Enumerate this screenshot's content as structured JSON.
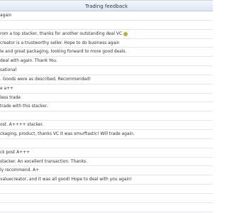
{
  "header": {
    "title": "Trading feedback"
  },
  "feedback": [
    {
      "text": "again"
    },
    {
      "text": ""
    },
    {
      "text": "rom a top stacker, thanks for another outstanding deal VC",
      "smiley": true
    },
    {
      "text": "creator is a trustworthy seller. Hope to do business again"
    },
    {
      "text": "le and great packaging, looking forward to more good deals."
    },
    {
      "text": "deal with again. Thank You."
    },
    {
      "text": "sational"
    },
    {
      "text": ". Goods were as described. Recommended!"
    },
    {
      "text": "e a++"
    },
    {
      "text": "less trade"
    },
    {
      "text": "trade with this stacker."
    },
    {
      "text": ""
    },
    {
      "text": "ost. A++++ stacker."
    },
    {
      "text": "ckaging, product, thanks VC it was smurftastic! Will trade again."
    },
    {
      "text": ""
    },
    {
      "text": "ck post A+++"
    },
    {
      "text": "stacker. An excellent transaction. Thanks."
    },
    {
      "text": "ly recommend. A+"
    },
    {
      "text": "valuecreator, and it was all good! Hope to deal with you again!"
    },
    {
      "text": ""
    },
    {
      "text": ""
    },
    {
      "text": ""
    }
  ],
  "colors": {
    "header_gradient_top": "#f4f7fb",
    "header_gradient_bottom": "#dde6f1",
    "row_border": "#e3e7ec",
    "smiley_fill": "#f7d21c"
  }
}
